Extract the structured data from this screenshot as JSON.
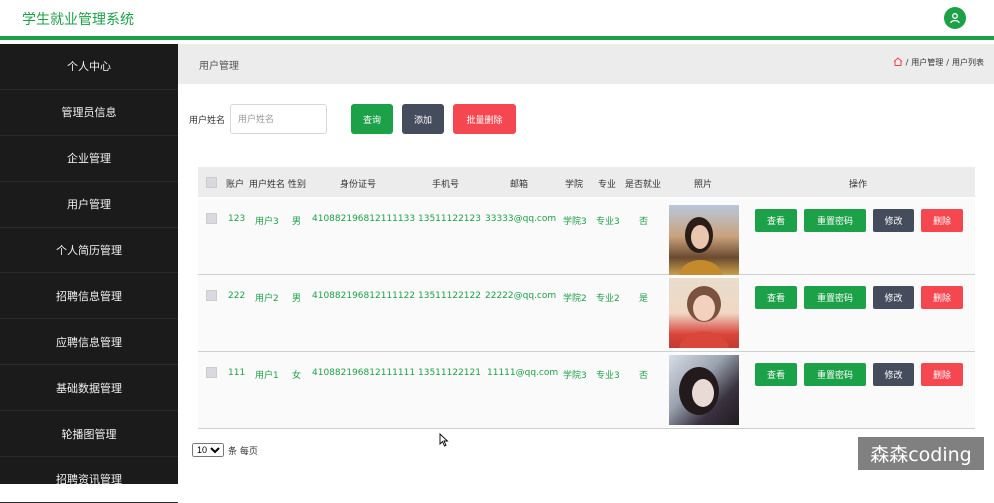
{
  "app": {
    "title": "学生就业管理系统"
  },
  "sidebar": {
    "items": [
      {
        "label": "个人中心"
      },
      {
        "label": "管理员信息"
      },
      {
        "label": "企业管理"
      },
      {
        "label": "用户管理"
      },
      {
        "label": "个人简历管理"
      },
      {
        "label": "招聘信息管理"
      },
      {
        "label": "应聘信息管理"
      },
      {
        "label": "基础数据管理"
      },
      {
        "label": "轮播图管理"
      },
      {
        "label": "招聘资讯管理"
      }
    ]
  },
  "topbar": {
    "title": "用户管理",
    "breadcrumb": [
      "用户管理",
      "用户列表"
    ],
    "separator": "/"
  },
  "search": {
    "label": "用户姓名",
    "placeholder": "用户姓名",
    "query_label": "查询",
    "add_label": "添加",
    "batch_delete_label": "批量删除"
  },
  "table": {
    "headers": [
      "账户",
      "用户姓名",
      "性别",
      "身份证号",
      "手机号",
      "邮箱",
      "学院",
      "专业",
      "是否就业",
      "照片",
      "操作"
    ],
    "rows": [
      {
        "account": "123",
        "name": "用户3",
        "gender": "男",
        "id_card": "410882196812111133",
        "phone": "13511122123",
        "email": "33333@qq.com",
        "college": "学院3",
        "major": "专业3",
        "employed": "否",
        "photo": "photo-1"
      },
      {
        "account": "222",
        "name": "用户2",
        "gender": "男",
        "id_card": "410882196812111122",
        "phone": "13511122122",
        "email": "22222@qq.com",
        "college": "学院2",
        "major": "专业2",
        "employed": "是",
        "photo": "photo-2"
      },
      {
        "account": "111",
        "name": "用户1",
        "gender": "女",
        "id_card": "410882196812111111",
        "phone": "13511122121",
        "email": "11111@qq.com",
        "college": "学院3",
        "major": "专业3",
        "employed": "否",
        "photo": "photo-3"
      }
    ],
    "actions": {
      "view": "查看",
      "reset": "重置密码",
      "edit": "修改",
      "delete": "删除"
    }
  },
  "pager": {
    "page_size": "10",
    "suffix": "条 每页"
  },
  "watermark": {
    "text": "森森coding"
  },
  "colors": {
    "brand": "#1ca048",
    "danger": "#f5474f",
    "dark": "#454c5c",
    "sidebar": "#1b1b1b"
  }
}
